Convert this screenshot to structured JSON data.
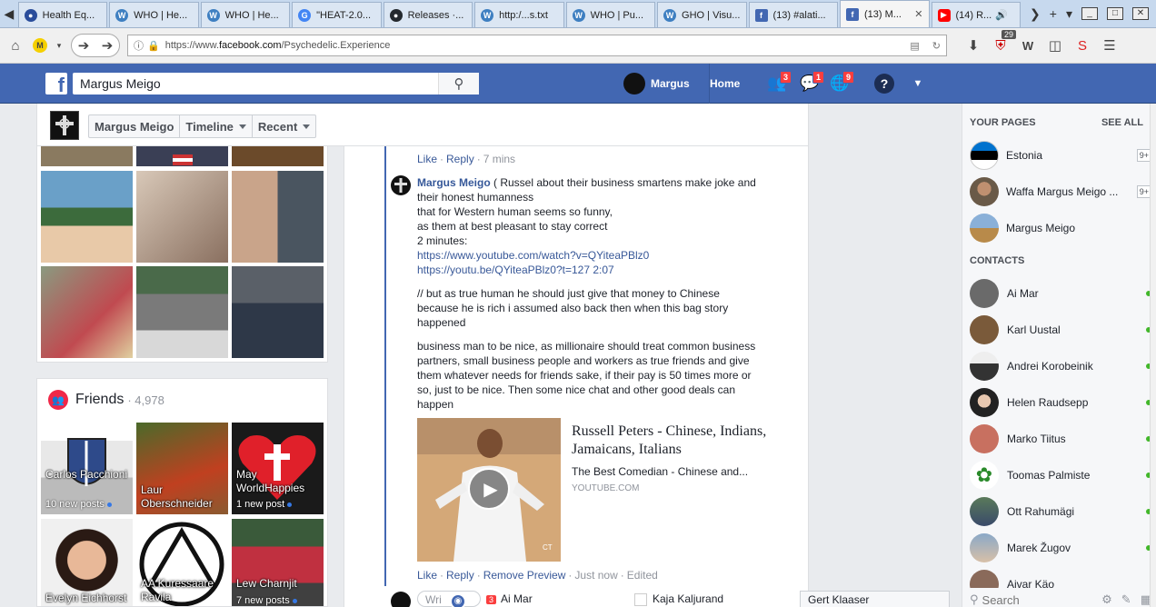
{
  "browser": {
    "tabs": [
      {
        "label": "Health Eq...",
        "icon": "globe-icon",
        "color": "#2a4d9b"
      },
      {
        "label": "WHO | He...",
        "icon": "who-icon",
        "color": "#3e7fc1"
      },
      {
        "label": "WHO | He...",
        "icon": "who-icon",
        "color": "#3e7fc1"
      },
      {
        "label": "\"HEAT-2.0...",
        "icon": "google-icon",
        "color": "#4285f4"
      },
      {
        "label": "Releases ·...",
        "icon": "github-icon",
        "color": "#24292e"
      },
      {
        "label": "http:/...s.txt",
        "icon": "who-icon",
        "color": "#3e7fc1"
      },
      {
        "label": "WHO | Pu...",
        "icon": "who-icon",
        "color": "#3e7fc1"
      },
      {
        "label": "GHO | Visu...",
        "icon": "who-icon",
        "color": "#3e7fc1"
      },
      {
        "label": "(13) #alati...",
        "icon": "facebook-icon",
        "color": "#4267b2"
      },
      {
        "label": "(13) M...",
        "icon": "facebook-icon",
        "color": "#4267b2",
        "active": true
      },
      {
        "label": "(14) R...",
        "icon": "youtube-icon",
        "color": "#ff0000"
      }
    ],
    "url_prefix": "https://www.",
    "url_host": "facebook.com",
    "url_path": "/Psychedelic.Experience",
    "ext_badge": "29"
  },
  "fb": {
    "search_value": "Margus Meigo",
    "user_name": "Margus",
    "home_label": "Home",
    "friend_requests": "3",
    "messages": "1",
    "notifications": "9",
    "brand_color": "#4267b2"
  },
  "timeline_nav": {
    "name": "Margus Meigo",
    "timeline": "Timeline",
    "recent": "Recent"
  },
  "friends": {
    "title": "Friends",
    "count": "· 4,978",
    "items": [
      {
        "name": "Carlos Pacchioni",
        "sub": "10 new posts"
      },
      {
        "name": "Laur Oberschneider",
        "sub": ""
      },
      {
        "name": "May WorldHappies",
        "sub": "1 new post"
      },
      {
        "name": "Evelyn Eichhorst",
        "sub": ""
      },
      {
        "name": "AA Kuressaare Ravila",
        "sub": ""
      },
      {
        "name": "Lew Charnjit",
        "sub": "7 new posts"
      }
    ]
  },
  "feed": {
    "prev_actions": {
      "like": "Like",
      "reply": "Reply",
      "time": "7 mins"
    },
    "comment": {
      "author": "Margus Meigo",
      "text_1": "( Russel about their business smartens make joke and their honest humanness",
      "lines_1": [
        "that for Western human seems so funny,",
        "as them at best pleasant to stay correct",
        "2 minutes:"
      ],
      "link_1": "https://www.youtube.com/watch?v=QYiteaPBlz0",
      "link_2": "https://youtu.be/QYiteaPBlz0?t=127 2:07",
      "para_2": "// but as true human he should just give that money to Chinese because he is rich i assumed also back then when this bag story happened",
      "para_3": "business man to be nice, as millionaire should treat common business partners, small business people and workers as true friends and give them whatever needs for friends sake, if their pay is 50 times more or so, just to be nice. Then some nice chat and other good deals can happen"
    },
    "preview": {
      "title": "Russell Peters - Chinese, Indians, Jamaicans, Italians",
      "desc": "The Best Comedian - Chinese and...",
      "domain": "YOUTUBE.COM",
      "watermark": "CT"
    },
    "actions": {
      "like": "Like",
      "reply": "Reply",
      "remove": "Remove Preview",
      "time": "Just now",
      "edited": "Edited"
    }
  },
  "sidebar": {
    "pages_title": "YOUR PAGES",
    "see_all": "SEE ALL",
    "pages": [
      {
        "name": "Estonia",
        "badge": "9+"
      },
      {
        "name": "Waffa Margus Meigo ...",
        "badge": "9+"
      },
      {
        "name": "Margus Meigo",
        "badge": ""
      }
    ],
    "contacts_title": "CONTACTS",
    "contacts": [
      {
        "name": "Ai Mar"
      },
      {
        "name": "Karl Uustal"
      },
      {
        "name": "Andrei Korobeinik"
      },
      {
        "name": "Helen Raudsepp"
      },
      {
        "name": "Marko Tiitus"
      },
      {
        "name": "Toomas Palmiste"
      },
      {
        "name": "Ott Rahumägi"
      },
      {
        "name": "Marek Žugov"
      },
      {
        "name": "Aivar Käo"
      }
    ],
    "search_placeholder": "Search"
  },
  "chat_tabs": {
    "write_placeholder": "Wri",
    "tab_1_badge": "3",
    "tab_1": "Ai Mar",
    "tab_2": "Kaja Kaljurand",
    "tab_3": "Gert Klaaser"
  }
}
